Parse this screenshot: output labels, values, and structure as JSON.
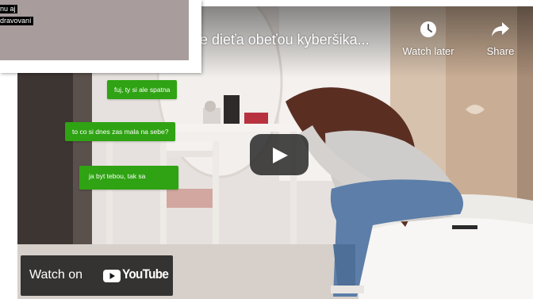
{
  "video": {
    "title": "e dieťa obeťou kyberšika...",
    "watch_later_label": "Watch later",
    "share_label": "Share",
    "watch_on_label": "Watch on",
    "youtube_wordmark": "YouTube",
    "chat_messages": [
      "fuj, ty si ale spatna",
      "to co si dnes zas mala na sebe?",
      "ja byt tebou, tak sa"
    ],
    "icons": {
      "watch_later": "clock-icon",
      "share": "share-arrow-icon",
      "play": "play-icon",
      "youtube_logo": "youtube-logo-icon"
    }
  },
  "card": {
    "lines": [
      "nu aj",
      "dravovaní"
    ]
  },
  "colors": {
    "chat_bubble": "#2fa313",
    "play_button_bg": "#212121",
    "card_image_bg": "#a89c9c",
    "youtube_red": "#ff0000"
  }
}
